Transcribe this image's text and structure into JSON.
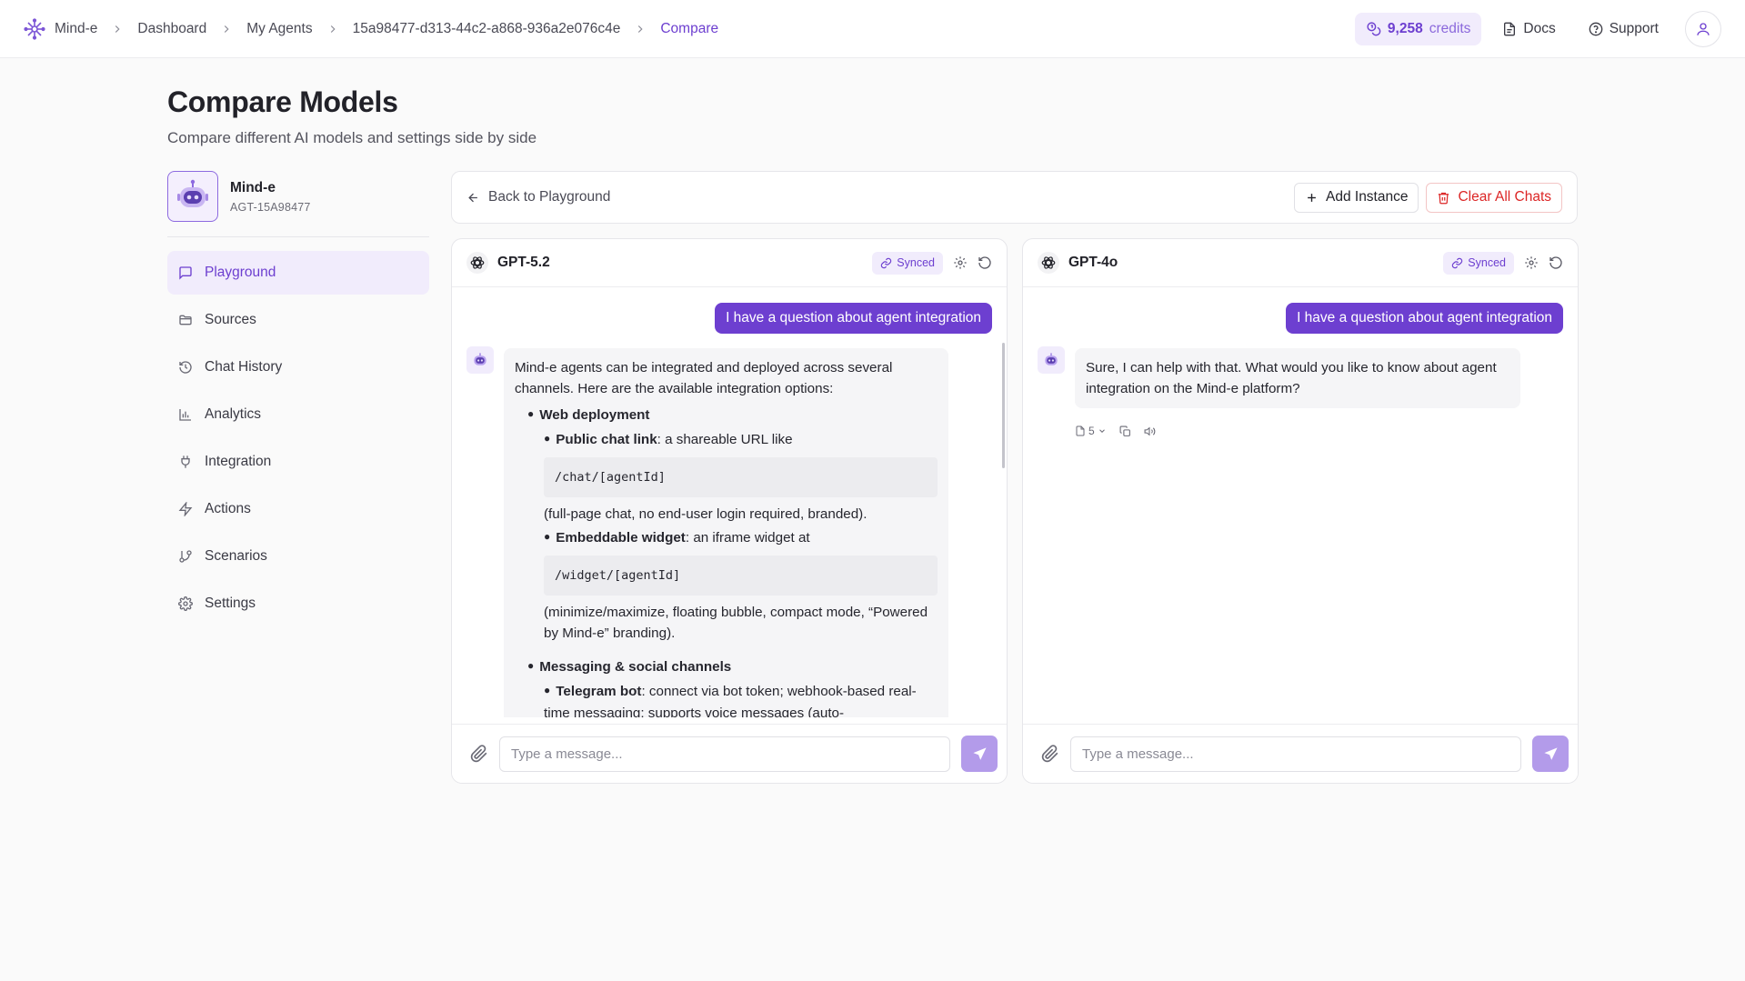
{
  "app": {
    "name": "Mind-e"
  },
  "breadcrumbs": [
    "Dashboard",
    "My Agents",
    "15a98477-d313-44c2-a868-936a2e076c4e",
    "Compare"
  ],
  "topbar": {
    "credits_value": "9,258",
    "credits_unit": "credits",
    "docs": "Docs",
    "support": "Support"
  },
  "page": {
    "title": "Compare Models",
    "subtitle": "Compare different AI models and settings side by side"
  },
  "agent": {
    "name": "Mind-e",
    "id": "AGT-15A98477"
  },
  "sidebar": {
    "items": [
      {
        "label": "Playground",
        "icon": "message-square-icon",
        "active": true
      },
      {
        "label": "Sources",
        "icon": "folder-icon"
      },
      {
        "label": "Chat History",
        "icon": "history-icon"
      },
      {
        "label": "Analytics",
        "icon": "bar-chart-icon"
      },
      {
        "label": "Integration",
        "icon": "plug-icon"
      },
      {
        "label": "Actions",
        "icon": "zap-icon"
      },
      {
        "label": "Scenarios",
        "icon": "git-branch-icon"
      },
      {
        "label": "Settings",
        "icon": "gear-icon"
      }
    ]
  },
  "toolbar": {
    "back": "Back to Playground",
    "add_instance": "Add Instance",
    "clear_all": "Clear All Chats"
  },
  "panels": [
    {
      "model": "GPT-5.2",
      "synced": "Synced",
      "user_message": "I have a question about agent integration",
      "bot": {
        "intro": "Mind-e agents can be integrated and deployed across several channels. Here are the available integration options:",
        "web_heading": "Web deployment",
        "public_link_label": "Public chat link",
        "public_link_text": ": a shareable URL like",
        "public_link_code": "/chat/[agentId]",
        "public_link_note": "(full-page chat, no end-user login required, branded).",
        "widget_label": "Embeddable widget",
        "widget_text": ": an iframe widget at",
        "widget_code": "/widget/[agentId]",
        "widget_note": "(minimize/maximize, floating bubble, compact mode, “Powered by Mind-e” branding).",
        "messaging_heading": "Messaging & social channels",
        "telegram_label": "Telegram bot",
        "telegram_text": ": connect via bot token; webhook-based real-time messaging; supports voice messages (auto-"
      },
      "input_placeholder": "Type a message..."
    },
    {
      "model": "GPT-4o",
      "synced": "Synced",
      "user_message": "I have a question about agent integration",
      "bot": {
        "reply": "Sure, I can help with that. What would you like to know about agent integration on the Mind-e platform?",
        "sources_count": "5"
      },
      "input_placeholder": "Type a message..."
    }
  ],
  "colors": {
    "accent": "#6d3fd0",
    "accent_soft": "#f1ecfc",
    "danger": "#dc2626",
    "send_disabled": "#b39bea"
  }
}
